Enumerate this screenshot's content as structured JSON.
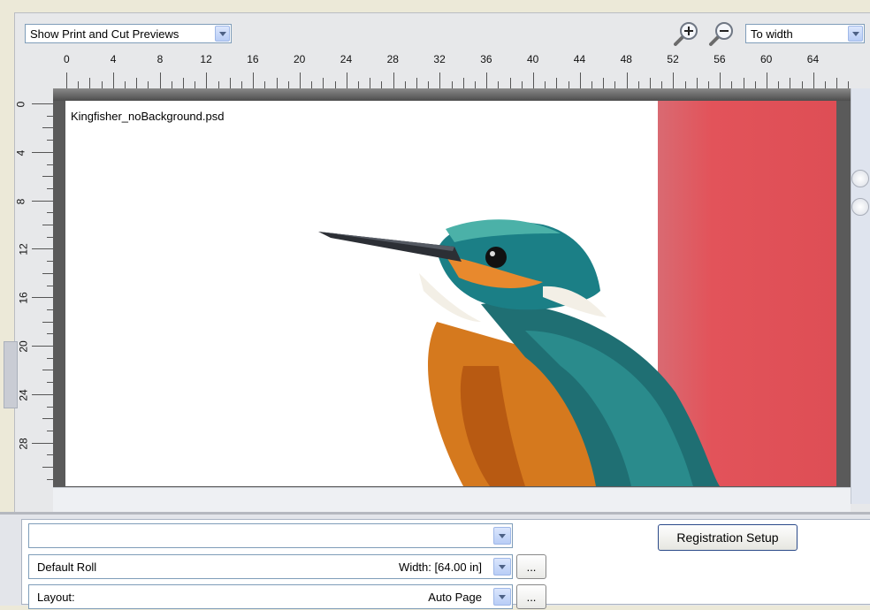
{
  "toolbar": {
    "preview_select": "Show Print and Cut Previews",
    "zoom_select": "To width",
    "zoom_in_icon": "zoom-in-icon",
    "zoom_out_icon": "zoom-out-icon"
  },
  "ruler": {
    "horizontal_labels": [
      "0",
      "4",
      "8",
      "12",
      "16",
      "20",
      "24",
      "28",
      "32",
      "36",
      "40",
      "44",
      "48",
      "52",
      "56",
      "60",
      "64"
    ],
    "vertical_labels": [
      "0",
      "4",
      "8",
      "12",
      "16",
      "20",
      "24",
      "28"
    ]
  },
  "canvas": {
    "filename": "Kingfisher_noBackground.psd"
  },
  "panel": {
    "profile_select": "",
    "registration_button": "Registration Setup",
    "media_label": "Default Roll",
    "media_width": "Width: [64.00 in]",
    "layout_label": "Layout:",
    "layout_value": "Auto Page",
    "more_label": "...",
    "colors": {
      "accent": "#7f9db9",
      "cut_zone": "#e2535a"
    }
  }
}
